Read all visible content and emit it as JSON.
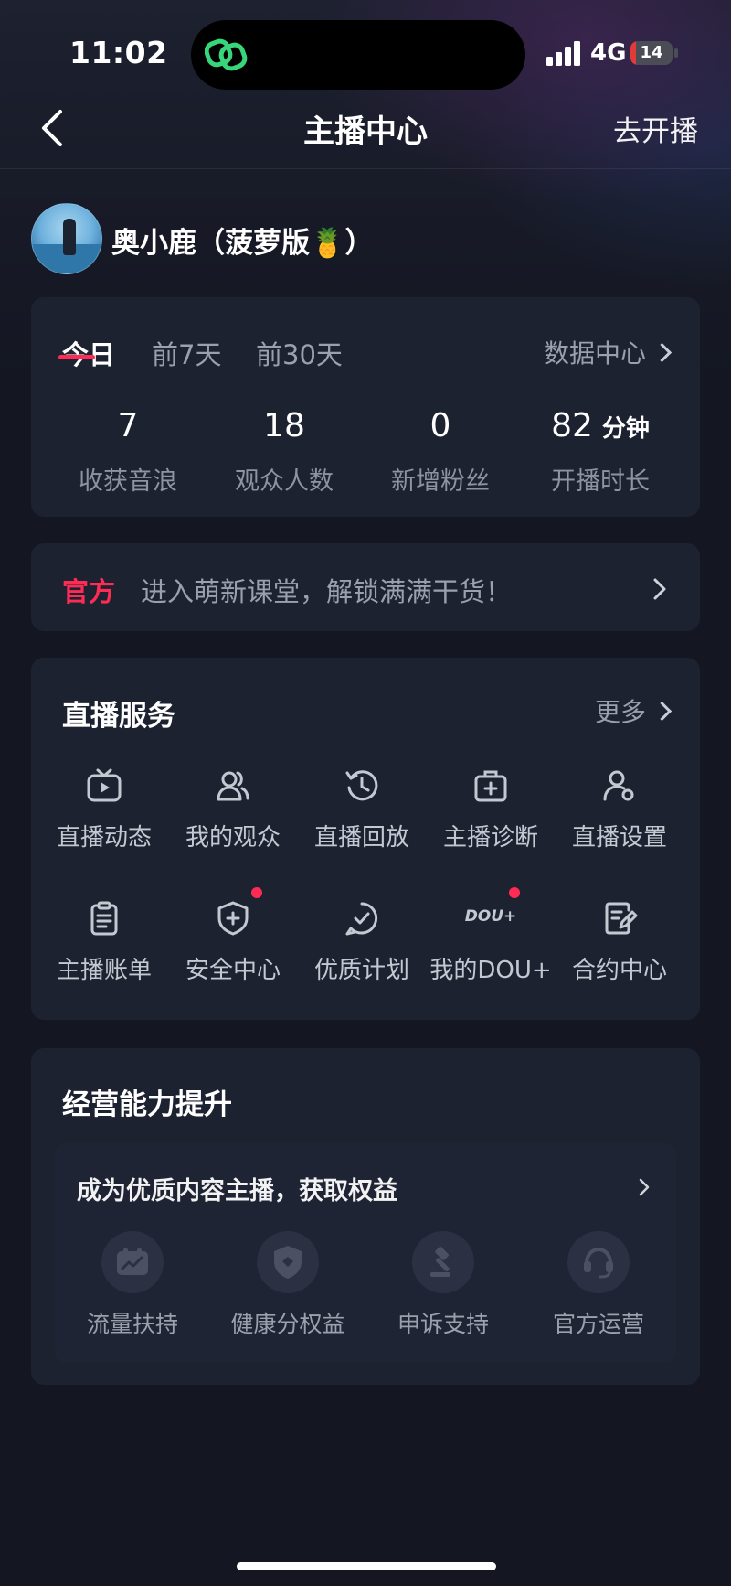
{
  "status_bar": {
    "time": "11:02",
    "network": "4G",
    "battery": "14",
    "battery_level": 0.14
  },
  "nav": {
    "title": "主播中心",
    "action": "去开播"
  },
  "profile": {
    "name": "奥小鹿（菠萝版🍍）"
  },
  "stats": {
    "tabs": [
      "今日",
      "前7天",
      "前30天"
    ],
    "active_tab": "今日",
    "data_center": "数据中心",
    "items": [
      {
        "value": "7",
        "unit": "",
        "label": "收获音浪"
      },
      {
        "value": "18",
        "unit": "",
        "label": "观众人数"
      },
      {
        "value": "0",
        "unit": "",
        "label": "新增粉丝"
      },
      {
        "value": "82",
        "unit": "分钟",
        "label": "开播时长"
      }
    ]
  },
  "banner": {
    "tag": "官方",
    "text": "进入萌新课堂，解锁满满干货！"
  },
  "live_service": {
    "title": "直播服务",
    "more": "更多",
    "items": [
      {
        "label": "直播动态",
        "icon": "tv-play-icon"
      },
      {
        "label": "我的观众",
        "icon": "users-icon"
      },
      {
        "label": "直播回放",
        "icon": "history-clock-icon"
      },
      {
        "label": "主播诊断",
        "icon": "medical-kit-icon"
      },
      {
        "label": "直播设置",
        "icon": "user-settings-icon"
      },
      {
        "label": "主播账单",
        "icon": "clipboard-icon"
      },
      {
        "label": "安全中心",
        "icon": "shield-plus-icon",
        "badge": true
      },
      {
        "label": "优质计划",
        "icon": "check-circle-icon"
      },
      {
        "label": "我的DOU+",
        "icon": "dou-plus-icon",
        "badge": true,
        "icon_text": "DOU+"
      },
      {
        "label": "合约中心",
        "icon": "contract-edit-icon"
      }
    ]
  },
  "business": {
    "title": "经营能力提升",
    "subtitle": "成为优质内容主播，获取权益",
    "items": [
      {
        "label": "流量扶持",
        "icon": "trend-chart-icon"
      },
      {
        "label": "健康分权益",
        "icon": "shield-icon"
      },
      {
        "label": "申诉支持",
        "icon": "gavel-icon"
      },
      {
        "label": "官方运营",
        "icon": "headset-icon"
      }
    ]
  }
}
